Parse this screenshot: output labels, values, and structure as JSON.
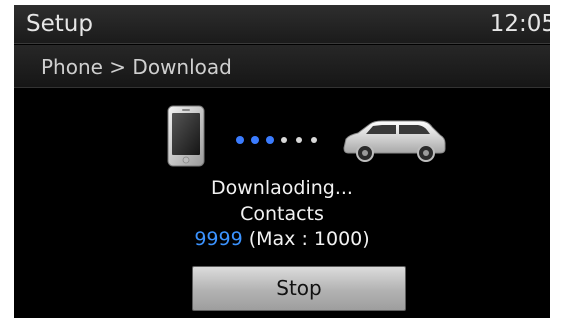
{
  "header": {
    "title": "Setup",
    "clock": "12:05"
  },
  "breadcrumb": "Phone > Download",
  "transfer": {
    "source_icon": "phone-icon",
    "target_icon": "car-icon",
    "dots_total": 6,
    "dots_active": 3,
    "active_dot_color": "#3b7cff",
    "inactive_dot_color": "#d8d8d8"
  },
  "status": {
    "line1": "Downlaoding...",
    "line2": "Contacts",
    "count": "9999",
    "max_text": " (Max : 1000)"
  },
  "buttons": {
    "stop": "Stop"
  },
  "colors": {
    "background": "#000000",
    "accent": "#3b93ff"
  }
}
